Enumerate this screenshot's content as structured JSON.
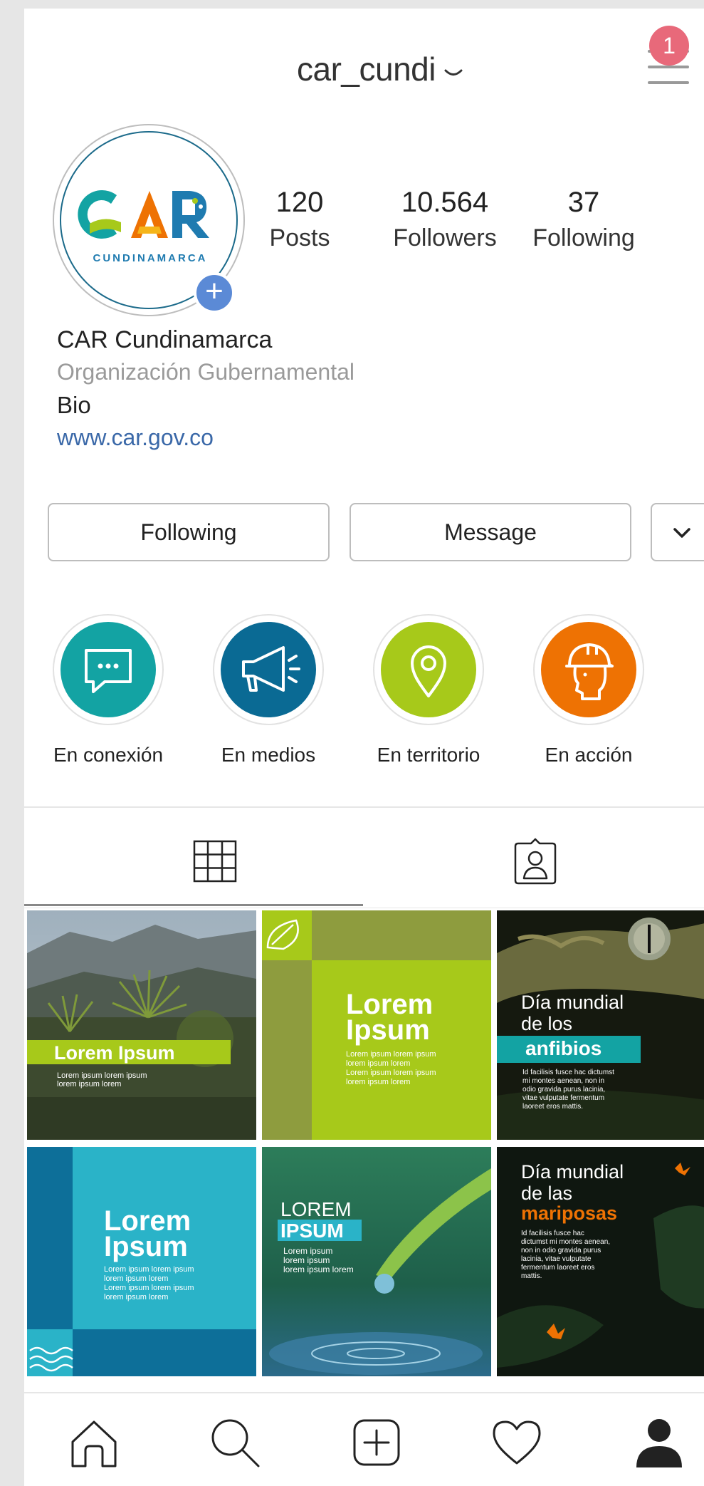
{
  "header": {
    "username": "car_cundi",
    "notification_count": "1"
  },
  "profile": {
    "avatar_caption": "CUNDINAMARCA",
    "stats": [
      {
        "value": "120",
        "label": "Posts"
      },
      {
        "value": "10.564",
        "label": "Followers"
      },
      {
        "value": "37",
        "label": "Following"
      }
    ],
    "name": "CAR Cundinamarca",
    "category": "Organización Gubernamental",
    "bio": "Bio",
    "website": "www.car.gov.co"
  },
  "actions": {
    "following_label": "Following",
    "message_label": "Message"
  },
  "highlights": [
    {
      "label": "En conexión",
      "color": "#13a3a3",
      "icon": "chat-bubble-icon"
    },
    {
      "label": "En medios",
      "color": "#0a6a94",
      "icon": "megaphone-icon"
    },
    {
      "label": "En territorio",
      "color": "#a7c91a",
      "icon": "map-pin-icon"
    },
    {
      "label": "En acción",
      "color": "#ee7203",
      "icon": "worker-helmet-icon"
    }
  ],
  "tabs": [
    {
      "name": "grid",
      "icon": "grid-icon",
      "active": true
    },
    {
      "name": "tagged",
      "icon": "tagged-user-icon",
      "active": false
    }
  ],
  "posts": [
    {
      "title": "Lorem Ipsum",
      "body": "Lorem ipsum lorem ipsum\nlorem ipsum lorem"
    },
    {
      "title_line1": "Lorem",
      "title_line2": "Ipsum",
      "body": "Lorem ipsum lorem ipsum\nlorem ipsum lorem\nLorem ipsum lorem ipsum\nlorem ipsum lorem"
    },
    {
      "line1": "Día mundial",
      "line2": "de los",
      "highlight": "anfibios",
      "body": "Id facilisis fusce hac dictumst\nmi montes aenean, non in\nodio gravida purus lacinia,\nvitae vulputate fermentum\nlaoreet eros mattis."
    },
    {
      "title_line1": "Lorem",
      "title_line2": "Ipsum",
      "body": "Lorem ipsum lorem ipsum\nlorem ipsum lorem\nLorem ipsum lorem ipsum\nlorem ipsum lorem"
    },
    {
      "title_line1": "LOREM",
      "title_line2": "IPSUM",
      "body": "Lorem ipsum\nlorem ipsum\nlorem ipsum lorem"
    },
    {
      "line1": "Día mundial",
      "line2": "de las",
      "highlight": "mariposas",
      "body": "Id facilisis fusce hac\ndictumst mi montes aenean,\nnon in odio gravida purus\nlacinia, vitae vulputate\nfermentum laoreet eros\nmattis."
    }
  ],
  "bottom_nav": [
    {
      "name": "home",
      "icon": "home-icon"
    },
    {
      "name": "search",
      "icon": "search-icon"
    },
    {
      "name": "new-post",
      "icon": "add-post-icon"
    },
    {
      "name": "activity",
      "icon": "heart-icon"
    },
    {
      "name": "profile",
      "icon": "profile-icon"
    }
  ],
  "colors": {
    "brand_green": "#a7c91a",
    "brand_teal": "#13a3a3",
    "brand_blue": "#0a6a94",
    "brand_orange": "#ee7203",
    "notification": "#e8697a",
    "link": "#3a68a8"
  }
}
